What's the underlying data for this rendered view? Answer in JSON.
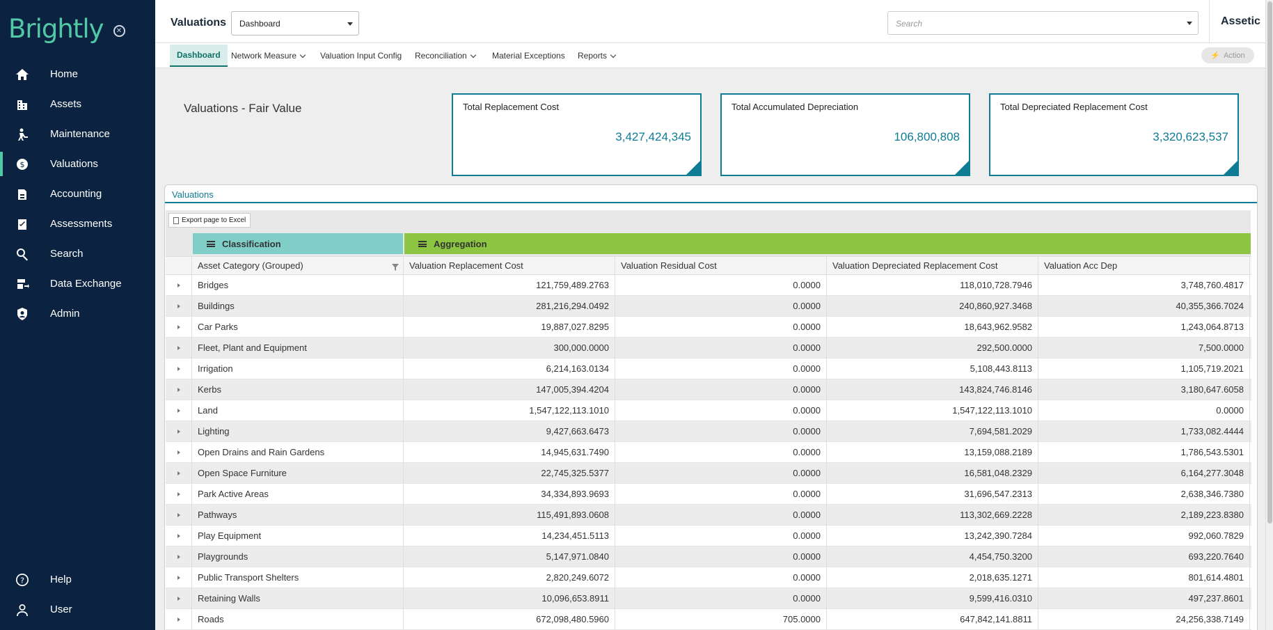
{
  "sidebar": {
    "logo": "Brightly",
    "items": [
      {
        "label": "Home",
        "icon": "home-icon"
      },
      {
        "label": "Assets",
        "icon": "assets-icon"
      },
      {
        "label": "Maintenance",
        "icon": "maintenance-icon"
      },
      {
        "label": "Valuations",
        "icon": "valuations-icon"
      },
      {
        "label": "Accounting",
        "icon": "accounting-icon"
      },
      {
        "label": "Assessments",
        "icon": "assessments-icon"
      },
      {
        "label": "Search",
        "icon": "search-icon"
      },
      {
        "label": "Data Exchange",
        "icon": "data-exchange-icon"
      },
      {
        "label": "Admin",
        "icon": "admin-icon"
      }
    ],
    "bottom": [
      {
        "label": "Help",
        "icon": "help-icon"
      },
      {
        "label": "User",
        "icon": "user-icon"
      }
    ],
    "accent_color": "#52c8a6",
    "bg_color": "#0b2340"
  },
  "header": {
    "title": "Valuations",
    "view_select": "Dashboard",
    "search_placeholder": "Search",
    "brand": "Assetic"
  },
  "tabs": {
    "items": [
      "Dashboard",
      "Network Measure",
      "Valuation Input Config",
      "Reconciliation",
      "Material Exceptions",
      "Reports"
    ],
    "action": "Action"
  },
  "page": {
    "heading": "Valuations - Fair Value",
    "kpis": [
      {
        "title": "Total Replacement Cost",
        "value": "3,427,424,345"
      },
      {
        "title": "Total Accumulated Depreciation",
        "value": "106,800,808"
      },
      {
        "title": "Total Depreciated Replacement Cost",
        "value": "3,320,623,537"
      }
    ],
    "panel_tab": "Valuations",
    "export_label": "Export page to Excel",
    "group_classification": "Classification",
    "group_aggregation": "Aggregation",
    "columns": [
      "Asset Category (Grouped)",
      "Valuation Replacement Cost",
      "Valuation Residual Cost",
      "Valuation Depreciated Replacement Cost",
      "Valuation Acc Dep"
    ],
    "rows": [
      [
        "Bridges",
        "121,759,489.2763",
        "0.0000",
        "118,010,728.7946",
        "3,748,760.4817"
      ],
      [
        "Buildings",
        "281,216,294.0492",
        "0.0000",
        "240,860,927.3468",
        "40,355,366.7024"
      ],
      [
        "Car Parks",
        "19,887,027.8295",
        "0.0000",
        "18,643,962.9582",
        "1,243,064.8713"
      ],
      [
        "Fleet, Plant and Equipment",
        "300,000.0000",
        "0.0000",
        "292,500.0000",
        "7,500.0000"
      ],
      [
        "Irrigation",
        "6,214,163.0134",
        "0.0000",
        "5,108,443.8113",
        "1,105,719.2021"
      ],
      [
        "Kerbs",
        "147,005,394.4204",
        "0.0000",
        "143,824,746.8146",
        "3,180,647.6058"
      ],
      [
        "Land",
        "1,547,122,113.1010",
        "0.0000",
        "1,547,122,113.1010",
        "0.0000"
      ],
      [
        "Lighting",
        "9,427,663.6473",
        "0.0000",
        "7,694,581.2029",
        "1,733,082.4444"
      ],
      [
        "Open Drains and Rain Gardens",
        "14,945,631.7490",
        "0.0000",
        "13,159,088.2189",
        "1,786,543.5301"
      ],
      [
        "Open Space Furniture",
        "22,745,325.5377",
        "0.0000",
        "16,581,048.2329",
        "6,164,277.3048"
      ],
      [
        "Park Active Areas",
        "34,334,893.9693",
        "0.0000",
        "31,696,547.2313",
        "2,638,346.7380"
      ],
      [
        "Pathways",
        "115,491,893.0608",
        "0.0000",
        "113,302,669.2228",
        "2,189,223.8380"
      ],
      [
        "Play Equipment",
        "14,234,451.5113",
        "0.0000",
        "13,242,390.7284",
        "992,060.7829"
      ],
      [
        "Playgrounds",
        "5,147,971.0840",
        "0.0000",
        "4,454,750.3200",
        "693,220.7640"
      ],
      [
        "Public Transport Shelters",
        "2,820,249.6072",
        "0.0000",
        "2,018,635.1271",
        "801,614.4801"
      ],
      [
        "Retaining Walls",
        "10,096,653.8911",
        "0.0000",
        "9,599,416.0310",
        "497,237.8601"
      ],
      [
        "Roads",
        "672,098,480.5960",
        "705.0000",
        "647,842,141.8811",
        "24,256,338.7149"
      ]
    ]
  }
}
